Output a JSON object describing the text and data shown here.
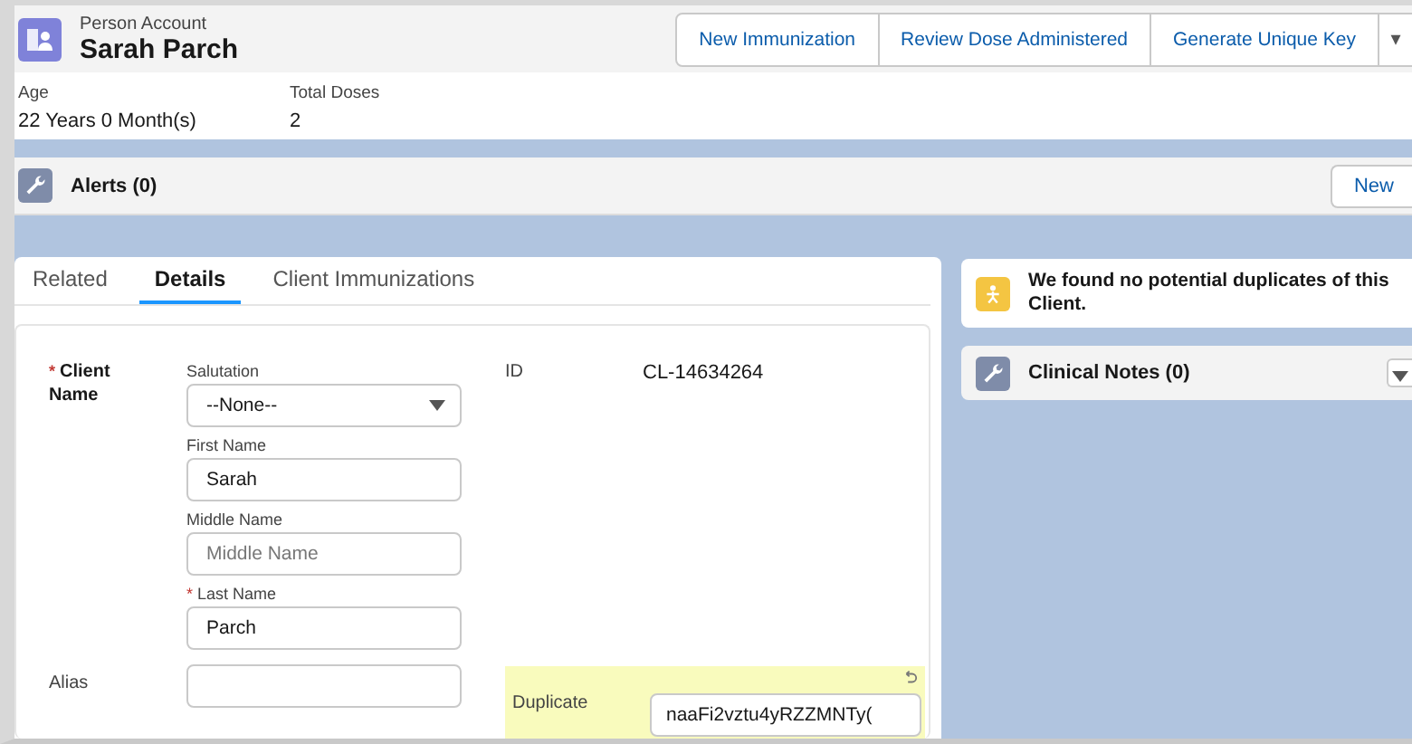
{
  "header": {
    "object_type": "Person Account",
    "title": "Sarah Parch",
    "actions": [
      "New Immunization",
      "Review Dose Administered",
      "Generate Unique Key"
    ],
    "more_menu": "▾"
  },
  "highlights": [
    {
      "label": "Age",
      "value": "22 Years 0 Month(s)"
    },
    {
      "label": "Total Doses",
      "value": "2"
    }
  ],
  "alerts": {
    "title": "Alerts (0)",
    "button": "New"
  },
  "tabs": [
    {
      "label": "Related",
      "selected": false
    },
    {
      "label": "Details",
      "selected": true
    },
    {
      "label": "Client Immunizations",
      "selected": false
    }
  ],
  "client_name": {
    "label": "Client Name",
    "required": true,
    "fields": [
      {
        "kind": "select",
        "label": "Salutation",
        "value": "--None--",
        "required": false
      },
      {
        "kind": "text",
        "label": "First Name",
        "value": "Sarah",
        "required": false
      },
      {
        "kind": "text",
        "label": "Middle Name",
        "placeholder": "Middle Name",
        "required": false
      },
      {
        "kind": "text",
        "label": "Last Name",
        "value": "Parch",
        "required": true
      }
    ]
  },
  "id_field": {
    "label": "ID",
    "value": "CL-14634264"
  },
  "alias": {
    "label": "Alias"
  },
  "duplicate_key": {
    "label": "Duplicate",
    "value": "naaFi2vztu4yRZZMNTy(",
    "changed": true
  },
  "duplicates_notice": "We found no potential duplicates of this Client.",
  "clinical_notes": {
    "title": "Clinical Notes (0)"
  },
  "required_mark": "*"
}
